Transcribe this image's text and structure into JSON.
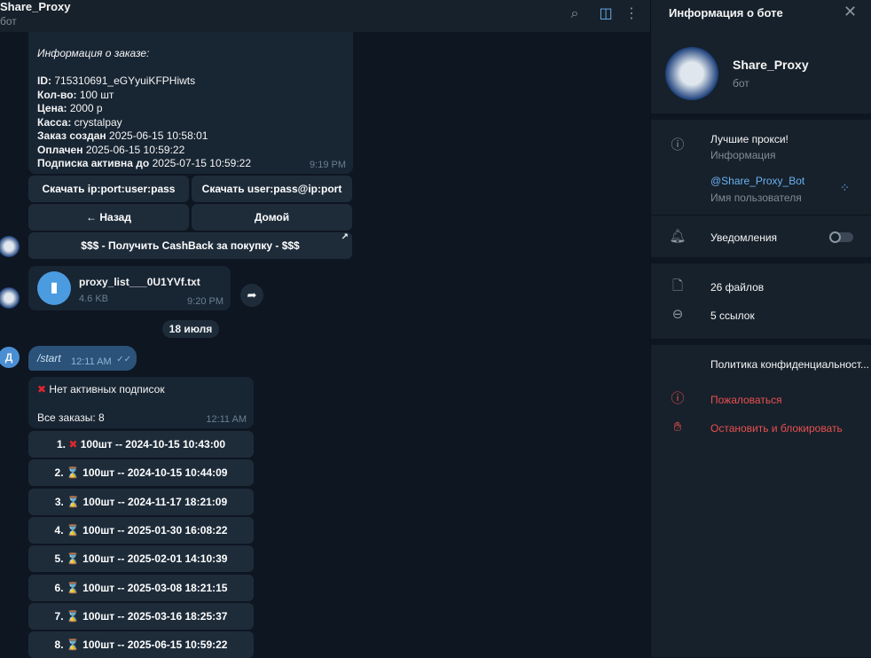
{
  "header": {
    "title": "Share_Proxy",
    "subtitle": "бот"
  },
  "order": {
    "heading": "Информация о заказе:",
    "id_label": "ID:",
    "id": "715310691_eGYyuiKFPHiwts",
    "qty_label": "Кол-во:",
    "qty": "100 шт",
    "price_label": "Цена:",
    "price": "2000 р",
    "kassa_label": "Касса:",
    "kassa": "crystalpay",
    "created_label": "Заказ создан",
    "created": "2025-06-15 10:58:01",
    "paid_label": "Оплачен",
    "paid": "2025-06-15 10:59:22",
    "active_label": "Подписка активна до",
    "active": "2025-07-15 10:59:22",
    "time": "9:19 PM"
  },
  "buttons": {
    "dl1": "Скачать ip:port:user:pass",
    "dl2": "Скачать user:pass@ip:port",
    "back": "← Назад",
    "home": "Домой",
    "cashback": "$$$ - Получить CashBack за покупку - $$$"
  },
  "file": {
    "name": "proxy_list___0U1YVf.txt",
    "size": "4.6 KB",
    "time": "9:20 PM"
  },
  "date_sep": "18 июля",
  "user_msg": {
    "avatar": "Д",
    "text": "/start",
    "time": "12:11 AM"
  },
  "status": {
    "text": "Нет активных подписок",
    "count": "Все заказы: 8",
    "time": "12:11 AM"
  },
  "orders": [
    {
      "label": "1.",
      "icon": "cross",
      "text": "100шт -- 2024-10-15 10:43:00"
    },
    {
      "label": "2.",
      "icon": "hourglass",
      "text": "100шт -- 2024-10-15 10:44:09"
    },
    {
      "label": "3.",
      "icon": "hourglass",
      "text": "100шт -- 2024-11-17 18:21:09"
    },
    {
      "label": "4.",
      "icon": "hourglass",
      "text": "100шт -- 2025-01-30 16:08:22"
    },
    {
      "label": "5.",
      "icon": "hourglass",
      "text": "100шт -- 2025-02-01 14:10:39"
    },
    {
      "label": "6.",
      "icon": "hourglass",
      "text": "100шт -- 2025-03-08 18:21:15"
    },
    {
      "label": "7.",
      "icon": "hourglass",
      "text": "100шт -- 2025-03-16 18:25:37"
    },
    {
      "label": "8.",
      "icon": "hourglass",
      "text": "100шт -- 2025-06-15 10:59:22"
    }
  ],
  "panel": {
    "title": "Информация о боте",
    "name": "Share_Proxy",
    "sub": "бот",
    "bio": "Лучшие прокси!",
    "bio_label": "Информация",
    "username": "@Share_Proxy_Bot",
    "username_label": "Имя пользователя",
    "notifications": "Уведомления",
    "notifications_on": false,
    "files": "26 файлов",
    "links": "5 ссылок",
    "privacy": "Политика конфиденциальност...",
    "report": "Пожаловаться",
    "block": "Остановить и блокировать"
  },
  "colors": {
    "accent": "#6ab2f2",
    "danger": "#e8504f",
    "bubble": "#182533",
    "bg": "#0e1621"
  }
}
